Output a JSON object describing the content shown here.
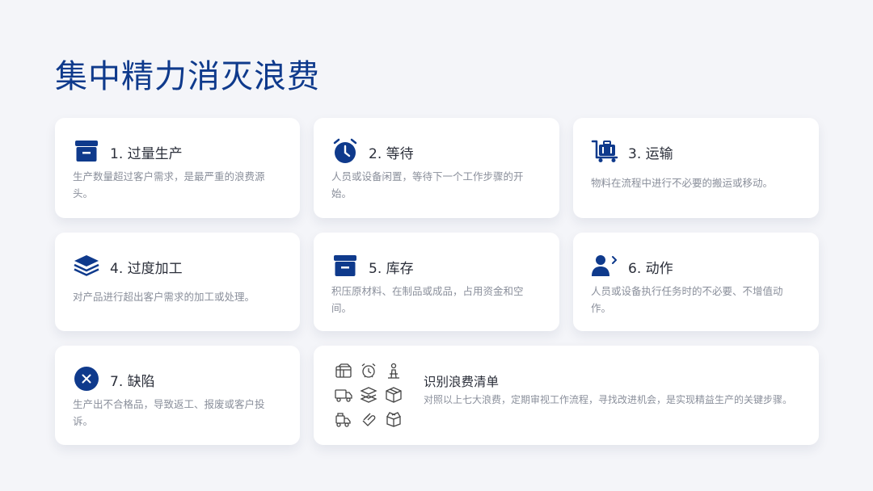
{
  "page": {
    "title": "集中精力消灭浪费"
  },
  "colors": {
    "accent": "#0f3a8c",
    "background": "#f4f5f9",
    "card": "#ffffff",
    "desc_text": "#8a8f9b"
  },
  "cards": [
    {
      "title": "1. 过量生产",
      "desc": "生产数量超过客户需求，是最严重的浪费源头。",
      "icon": "box-icon"
    },
    {
      "title": "2. 等待",
      "desc": "人员或设备闲置，等待下一个工作步骤的开始。",
      "icon": "alarm-clock-icon"
    },
    {
      "title": "3. 运输",
      "desc": "物料在流程中进行不必要的搬运或移动。",
      "icon": "luggage-cart-icon"
    },
    {
      "title": "4. 过度加工",
      "desc": "对产品进行超出客户需求的加工或处理。",
      "icon": "layers-icon"
    },
    {
      "title": "5. 库存",
      "desc": "积压原材料、在制品或成品，占用资金和空间。",
      "icon": "inventory-box-icon"
    },
    {
      "title": "6. 动作",
      "desc": "人员或设备执行任务时的不必要、不增值动作。",
      "icon": "user-motion-icon"
    },
    {
      "title": "7. 缺陷",
      "desc": "生产出不合格品，导致返工、报废或客户投诉。",
      "icon": "defect-x-icon"
    }
  ],
  "summary": {
    "title": "识别浪费清单",
    "desc": "对照以上七大浪费，定期审视工作流程，寻找改进机会，是实现精益生产的关键步骤。",
    "icons": [
      "boxes-icon",
      "alarm-clock-icon",
      "worker-icon",
      "truck-icon",
      "stack-icon",
      "package-icon",
      "forklift-icon",
      "hand-icon",
      "open-box-icon"
    ]
  }
}
